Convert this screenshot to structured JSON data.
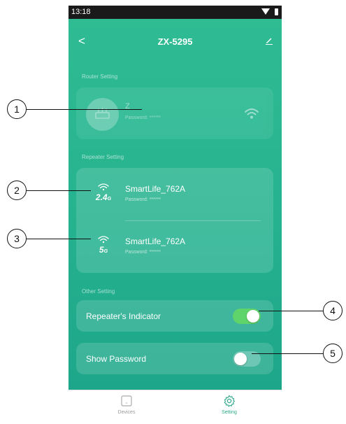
{
  "status_bar": {
    "time": "13:18"
  },
  "header": {
    "back_glyph": "<",
    "title": "ZX-5295",
    "edit_icon": "pencil-icon"
  },
  "router_setting": {
    "section_label": "Router Setting",
    "name": "Z",
    "password_label": "Password:",
    "password_value": "******"
  },
  "repeater_setting": {
    "section_label": "Repeater Setting",
    "items": [
      {
        "band": "2.4",
        "band_unit": "G",
        "ssid": "SmartLife_762A",
        "password_label": "Password:",
        "password_value": "******"
      },
      {
        "band": "5",
        "band_unit": "G",
        "ssid": "SmartLife_762A",
        "password_label": "Password:",
        "password_value": "******"
      }
    ]
  },
  "other_setting": {
    "section_label": "Other Setting",
    "repeater_indicator": {
      "label": "Repeater's Indicator",
      "on": true
    },
    "show_password": {
      "label": "Show Password",
      "on": false
    }
  },
  "tabbar": {
    "devices_label": "Devices",
    "setting_label": "Setting"
  },
  "callouts": [
    "1",
    "2",
    "3",
    "4",
    "5"
  ],
  "colors": {
    "accent": "#2fbc93",
    "toggle_on": "#5fd46a",
    "active_tab": "#2fa98a"
  }
}
